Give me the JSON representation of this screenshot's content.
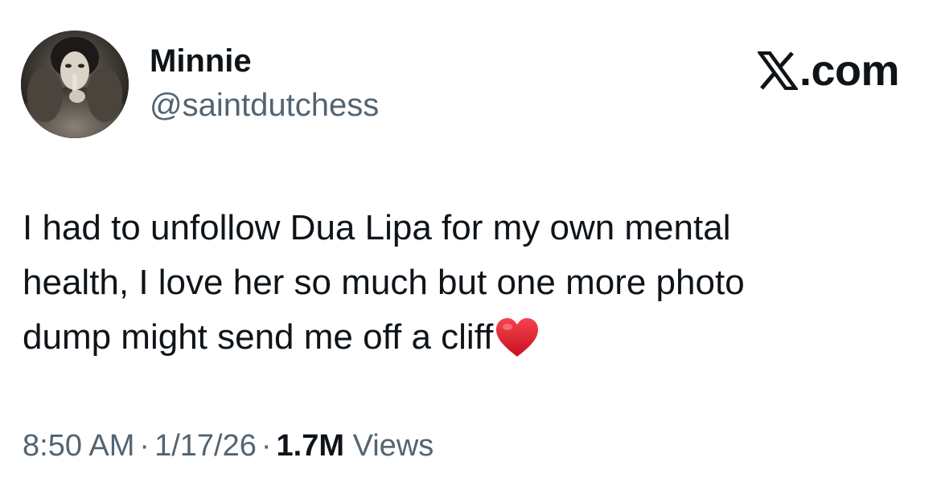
{
  "author": {
    "display_name": "Minnie",
    "handle": "@saintdutchess",
    "avatar_icon": "profile-photo"
  },
  "brand": {
    "icon": "x-logo-icon",
    "text": ".com"
  },
  "tweet": {
    "lines": [
      "I had to unfollow Dua Lipa for my own mental",
      "health, I love her so much but one more photo",
      "dump might send me off a cliff"
    ],
    "emoji": "red-heart-emoji"
  },
  "meta": {
    "time": "8:50 AM",
    "separator": "·",
    "date": "1/17/26",
    "views_count": "1.7M",
    "views_label": "Views"
  },
  "colors": {
    "text_primary": "#0f1419",
    "text_secondary": "#536471",
    "heart": "#e0212f",
    "background": "#ffffff"
  }
}
